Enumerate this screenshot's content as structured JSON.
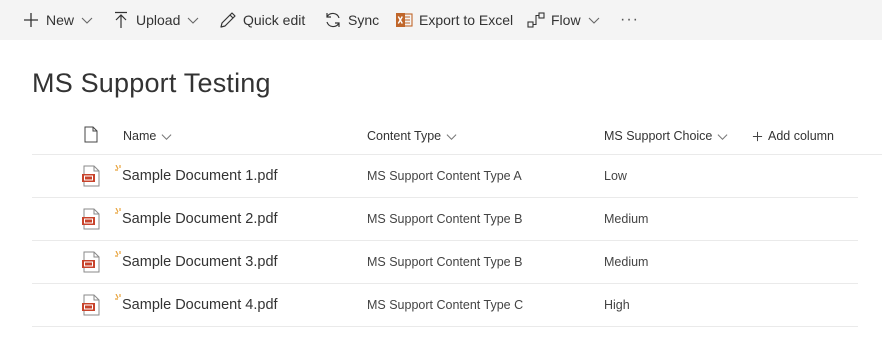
{
  "toolbar": {
    "new_label": "New",
    "upload_label": "Upload",
    "quick_edit_label": "Quick edit",
    "sync_label": "Sync",
    "export_label": "Export to Excel",
    "flow_label": "Flow",
    "more_label": "···"
  },
  "page": {
    "title": "MS Support Testing"
  },
  "columns": {
    "name": "Name",
    "content_type": "Content Type",
    "choice": "MS Support Choice",
    "add_column": "Add column"
  },
  "rows": [
    {
      "name": "Sample Document 1.pdf",
      "content_type": "MS Support Content Type A",
      "choice": "Low"
    },
    {
      "name": "Sample Document 2.pdf",
      "content_type": "MS Support Content Type B",
      "choice": "Medium"
    },
    {
      "name": "Sample Document 3.pdf",
      "content_type": "MS Support Content Type B",
      "choice": "Medium"
    },
    {
      "name": "Sample Document 4.pdf",
      "content_type": "MS Support Content Type C",
      "choice": "High"
    }
  ],
  "colors": {
    "command_bar_bg": "#f4f4f4",
    "text": "#333333",
    "pdf_red": "#c8432b",
    "excel_orange": "#c0662a",
    "new_badge": "#e8a33d",
    "divider": "#eaeaea"
  },
  "icons": {
    "new": "plus-icon",
    "upload": "upload-arrow-icon",
    "quick_edit": "pencil-icon",
    "sync": "sync-icon",
    "export": "excel-icon",
    "flow": "flow-icon",
    "file_type_header": "document-icon",
    "file": "pdf-file-icon",
    "new_item": "new-item-sparkle-icon"
  }
}
